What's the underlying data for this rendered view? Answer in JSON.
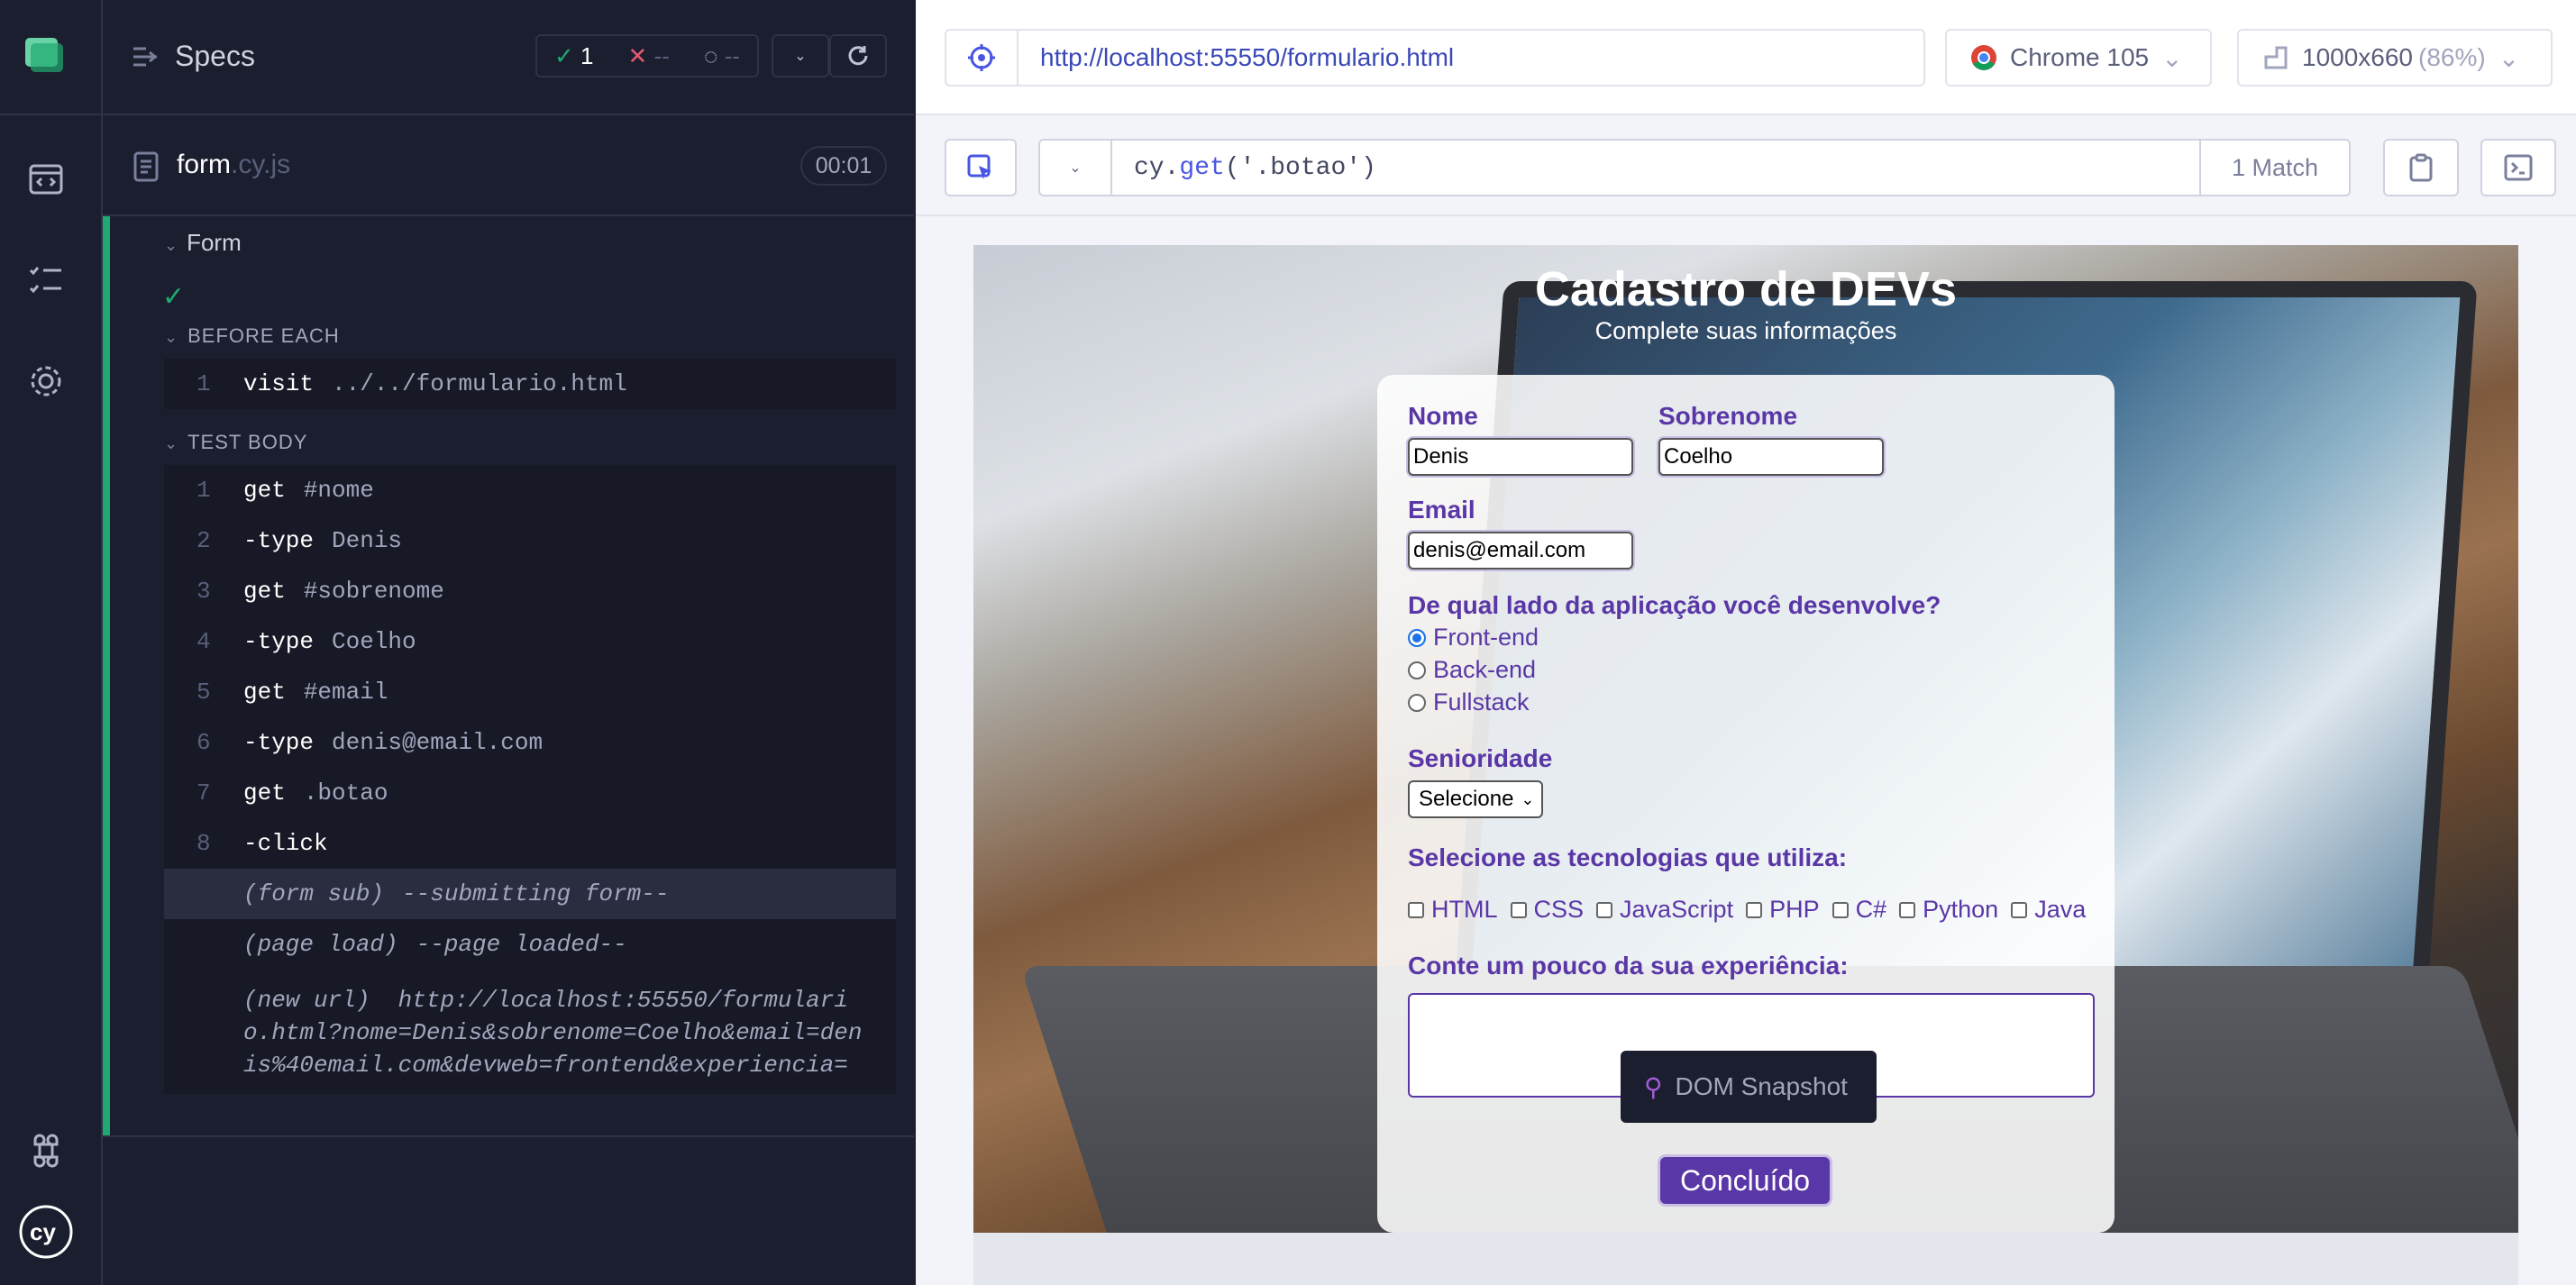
{
  "sidebar": {
    "icons": [
      "cypress-logo-icon",
      "specs-icon",
      "runs-icon",
      "settings-icon",
      "keyboard-shortcuts-icon",
      "cy-logo-icon"
    ]
  },
  "reporter": {
    "specs_label": "Specs",
    "passed_count": "1",
    "failed_count": "--",
    "pending_count": "--",
    "file_name": "form",
    "file_ext": ".cy.js",
    "duration": "00:01",
    "suite_title": "Form",
    "before_each_label": "BEFORE EACH",
    "test_body_label": "TEST BODY",
    "before_each": [
      {
        "n": "1",
        "cmd": "visit",
        "arg": "../../formulario.html"
      }
    ],
    "commands": [
      {
        "n": "1",
        "cmd": "get",
        "arg": "#nome"
      },
      {
        "n": "2",
        "cmd": "-type",
        "arg": "Denis"
      },
      {
        "n": "3",
        "cmd": "get",
        "arg": "#sobrenome"
      },
      {
        "n": "4",
        "cmd": "-type",
        "arg": "Coelho"
      },
      {
        "n": "5",
        "cmd": "get",
        "arg": "#email"
      },
      {
        "n": "6",
        "cmd": "-type",
        "arg": "denis@email.com"
      },
      {
        "n": "7",
        "cmd": "get",
        "arg": ".botao"
      },
      {
        "n": "8",
        "cmd": "-click",
        "arg": ""
      }
    ],
    "events": [
      {
        "name": "(form sub)",
        "msg": "--submitting form--"
      },
      {
        "name": "(page load)",
        "msg": "--page loaded--"
      }
    ],
    "new_url_label": "(new url)",
    "new_url": "http://localhost:55550/formulario.html?nome=Denis&sobrenome=Coelho&email=denis%40email.com&devweb=frontend&experiencia="
  },
  "aut_header": {
    "url": "http://localhost:55550/formulario.html",
    "browser": "Chrome 105",
    "viewport": "1000x660",
    "viewport_scale": "(86%)",
    "selector_prefix": "cy",
    "selector_method": "get",
    "selector_value": "('.botao')",
    "match_count": "1 Match"
  },
  "form_page": {
    "title": "Cadastro de DEVs",
    "subtitle": "Complete suas informações",
    "nome_label": "Nome",
    "nome_value": "Denis",
    "sobrenome_label": "Sobrenome",
    "sobrenome_value": "Coelho",
    "email_label": "Email",
    "email_value": "denis@email.com",
    "side_question": "De qual lado da aplicação você desenvolve?",
    "sides": [
      "Front-end",
      "Back-end",
      "Fullstack"
    ],
    "side_selected": "Front-end",
    "senioridade_label": "Senioridade",
    "senioridade_value": "Selecione",
    "tech_question": "Selecione as tecnologias que utiliza:",
    "techs": [
      "HTML",
      "CSS",
      "JavaScript",
      "PHP",
      "C#",
      "Python",
      "Java"
    ],
    "experience_label": "Conte um pouco da sua experiência:",
    "submit_label": "Concluído"
  },
  "snapshot_tooltip": "DOM Snapshot"
}
